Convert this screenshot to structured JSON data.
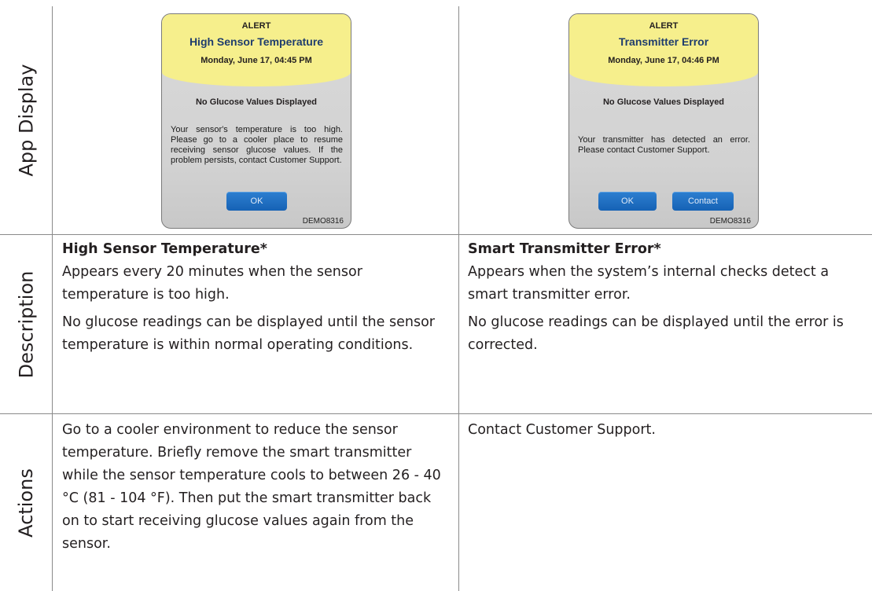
{
  "row_labels": {
    "app_display": "App Display",
    "description": "Description",
    "actions": "Actions"
  },
  "screens": {
    "left": {
      "alert": "ALERT",
      "title": "High Sensor Temperature",
      "date": "Monday, June 17, 04:45 PM",
      "no_values": "No Glucose Values Displayed",
      "message": "Your sensor's temperature is too high. Please go to a cooler place to resume receiving sensor glucose values. If the problem persists, contact Customer Support.",
      "ok_button": "OK",
      "footer_code": "DEMO8316"
    },
    "right": {
      "alert": "ALERT",
      "title": "Transmitter Error",
      "date": "Monday, June 17, 04:46 PM",
      "no_values": "No Glucose Values Displayed",
      "message": "Your transmitter has detected an error. Please contact Customer Support.",
      "ok_button": "OK",
      "contact_button": "Contact",
      "footer_code": "DEMO8316"
    }
  },
  "description": {
    "left": {
      "heading": "High Sensor Temperature*",
      "para1": "Appears every 20 minutes when the sensor temperature is too high.",
      "para2": "No glucose readings can be displayed until the sensor temperature is within normal operating conditions."
    },
    "right": {
      "heading": "Smart Transmitter Error*",
      "para1": "Appears when the system’s internal checks detect a smart transmitter error.",
      "para2": "No glucose readings can be displayed until the error is corrected."
    }
  },
  "actions": {
    "left": "Go to a cooler environment to reduce the sensor temperature. Briefly remove the smart transmitter while the sensor temperature cools to between 26 - 40 °C (81 - 104 °F). Then put the smart transmitter back on to start receiving glucose values again from the sensor.",
    "right": "Contact Customer Support."
  },
  "colors": {
    "header_yellow": "#f6ef8c",
    "title_blue": "#1f3d6d",
    "button_blue": "#1662b5",
    "grid": "#8a8a8a"
  }
}
